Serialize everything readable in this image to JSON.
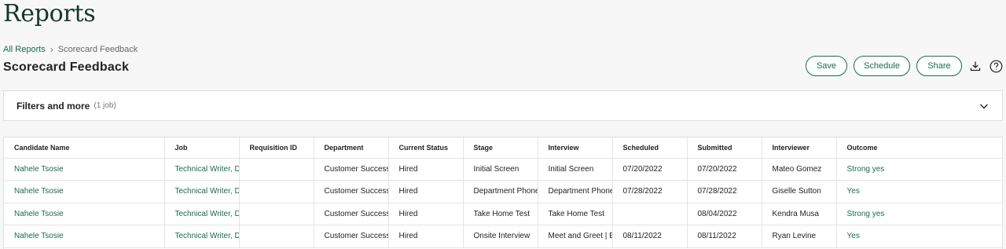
{
  "page": {
    "title": "Reports"
  },
  "breadcrumb": {
    "parent": "All Reports",
    "separator": "›",
    "current": "Scorecard Feedback"
  },
  "report": {
    "title": "Scorecard Feedback"
  },
  "toolbar": {
    "save_label": "Save",
    "schedule_label": "Schedule",
    "share_label": "Share",
    "download_icon": "download-icon",
    "help_icon": "help-icon"
  },
  "filters": {
    "label": "Filters and more",
    "count": "(1 job)"
  },
  "table": {
    "columns": [
      "Candidate Name",
      "Job",
      "Requisition ID",
      "Department",
      "Current Status",
      "Stage",
      "Interview",
      "Scheduled",
      "Submitted",
      "Interviewer",
      "Outcome"
    ],
    "rows": [
      [
        "Nahele Tsosie",
        "Technical Writer, D",
        "",
        "Customer Success",
        "Hired",
        "Initial Screen",
        "Initial Screen",
        "07/20/2022",
        "07/20/2022",
        "Mateo Gomez",
        "Strong yes"
      ],
      [
        "Nahele Tsosie",
        "Technical Writer, D",
        "",
        "Customer Success",
        "Hired",
        "Department Phone",
        "Department Phone",
        "07/28/2022",
        "07/28/2022",
        "Giselle Sutton",
        "Yes"
      ],
      [
        "Nahele Tsosie",
        "Technical Writer, D",
        "",
        "Customer Success",
        "Hired",
        "Take Home Test",
        "Take Home Test",
        "",
        "08/04/2022",
        "Kendra Musa",
        "Strong yes"
      ],
      [
        "Nahele Tsosie",
        "Technical Writer, D",
        "",
        "Customer Success",
        "Hired",
        "Onsite Interview",
        "Meet and Greet | E",
        "08/11/2022",
        "08/11/2022",
        "Ryan Levine",
        "Yes"
      ]
    ]
  },
  "colors": {
    "accent": "#1a6c4e",
    "title": "#15372c",
    "background": "#f7f7f7"
  }
}
